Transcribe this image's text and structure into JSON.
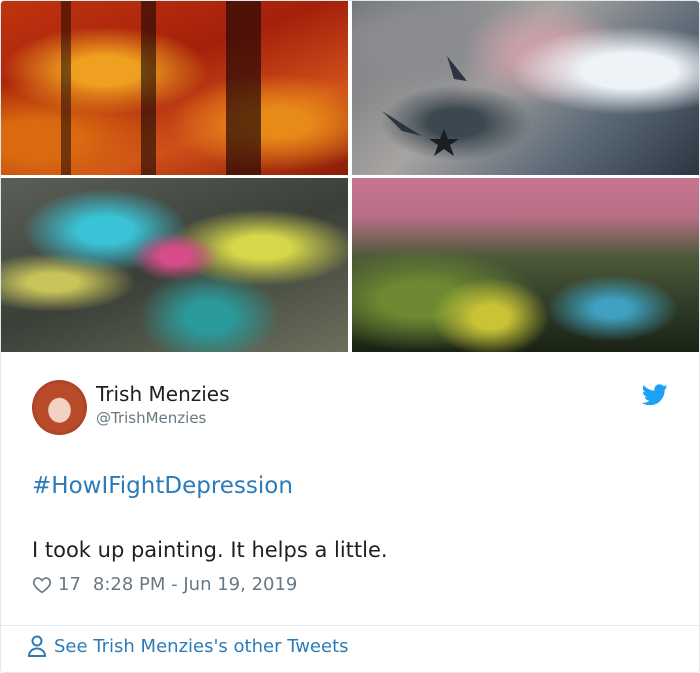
{
  "images": [
    {
      "label": "red abstract painting"
    },
    {
      "label": "grey abstract painting with star"
    },
    {
      "label": "colorful burst painting"
    },
    {
      "label": "forest painting with pink sky"
    }
  ],
  "author": {
    "name": "Trish Menzies",
    "handle": "@TrishMenzies"
  },
  "tweet": {
    "hashtag": "#HowIFightDepression",
    "text": "I took up painting. It helps a little.",
    "likes": "17",
    "timestamp": "8:28 PM - Jun 19, 2019"
  },
  "footer": {
    "link_text": "See Trish Menzies's other Tweets"
  },
  "colors": {
    "link": "#2b7bb9",
    "secondary_text": "#697882",
    "twitter_blue": "#1da1f2"
  },
  "icons": [
    "twitter-bird-icon",
    "heart-icon",
    "person-icon"
  ]
}
